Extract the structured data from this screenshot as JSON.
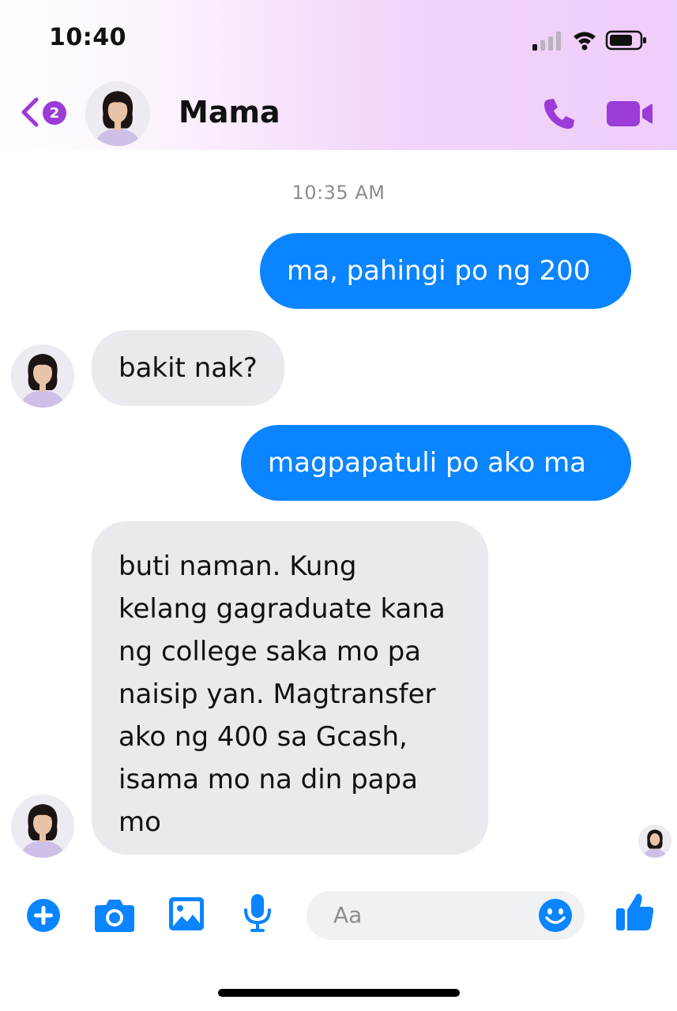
{
  "status_bar": {
    "time": "10:40"
  },
  "header": {
    "back_badge": "2",
    "contact_name": "Mama"
  },
  "conversation": {
    "timestamp": "10:35 AM",
    "messages": [
      {
        "from": "me",
        "text": "ma, pahingi po ng 200"
      },
      {
        "from": "Mama",
        "text": "bakit nak?"
      },
      {
        "from": "me",
        "text": "magpapatuli po ako ma"
      },
      {
        "from": "Mama",
        "lines": [
          "buti naman. Kung",
          "kelang gagraduate kana",
          "ng college saka mo pa",
          "naisip yan. Magtransfer",
          "ako ng 400 sa Gcash,",
          "isama mo na din papa",
          "mo"
        ]
      }
    ]
  },
  "composer": {
    "placeholder": "Aa"
  },
  "colors": {
    "accent": "#9b3bd8",
    "outgoing_bubble": "#0a84ff",
    "incoming_bubble": "#e9e9ee",
    "composer_icons": "#0a84ff"
  },
  "icons": [
    "back-chevron-icon",
    "phone-icon",
    "video-camera-icon",
    "plus-icon",
    "camera-icon",
    "image-icon",
    "microphone-icon",
    "emoji-icon",
    "thumbs-up-icon"
  ]
}
